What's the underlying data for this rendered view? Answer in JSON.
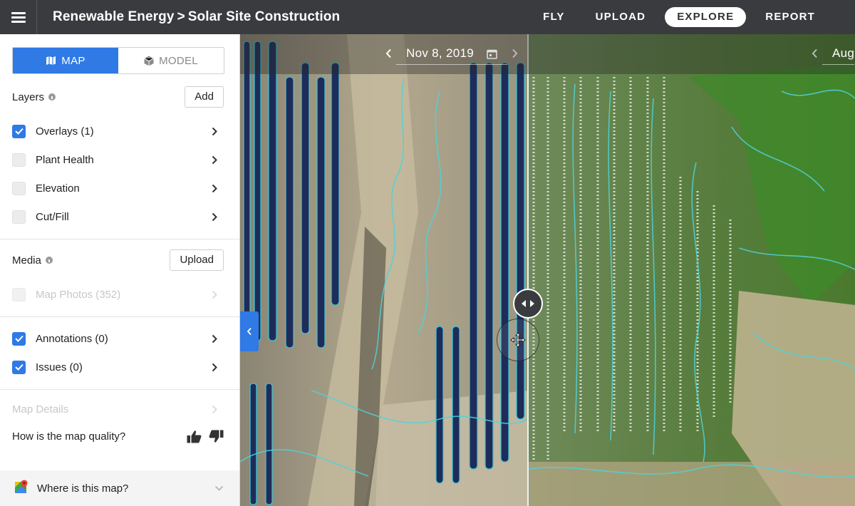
{
  "header": {
    "breadcrumb_project": "Renewable Energy",
    "breadcrumb_separator": ">",
    "breadcrumb_site": "Solar Site Construction",
    "nav": [
      {
        "label": "FLY",
        "active": false
      },
      {
        "label": "UPLOAD",
        "active": false
      },
      {
        "label": "EXPLORE",
        "active": true
      },
      {
        "label": "REPORT",
        "active": false
      }
    ]
  },
  "view_toggle": {
    "map_label": "MAP",
    "model_label": "MODEL",
    "active": "map"
  },
  "layers": {
    "title": "Layers",
    "add_label": "Add",
    "items": [
      {
        "label": "Overlays (1)",
        "checked": true
      },
      {
        "label": "Plant Health",
        "checked": false
      },
      {
        "label": "Elevation",
        "checked": false
      },
      {
        "label": "Cut/Fill",
        "checked": false
      }
    ]
  },
  "media": {
    "title": "Media",
    "upload_label": "Upload",
    "items": [
      {
        "label": "Map Photos (352)",
        "checked": false,
        "disabled": true
      }
    ]
  },
  "annotations": {
    "items": [
      {
        "label": "Annotations (0)",
        "checked": true
      },
      {
        "label": "Issues (0)",
        "checked": true
      }
    ]
  },
  "map_details": {
    "label": "Map Details",
    "disabled": true
  },
  "feedback": {
    "question": "How is the map quality?"
  },
  "location": {
    "label": "Where is this map?"
  },
  "map": {
    "left_date": "Nov 8, 2019",
    "right_date": "Aug"
  },
  "colors": {
    "accent": "#2f7ae5",
    "topbar": "#3a3b3e",
    "contour": "#4fd3d9"
  },
  "icons": {
    "menu": "hamburger-icon",
    "map": "map-icon",
    "model": "cube-icon",
    "info": "info-icon",
    "chevron": "chevron-right-icon",
    "calendar": "calendar-icon",
    "thumbs_up": "thumbs-up-icon",
    "thumbs_down": "thumbs-down-icon",
    "location": "google-maps-icon",
    "swipe": "swipe-handle-icon"
  }
}
